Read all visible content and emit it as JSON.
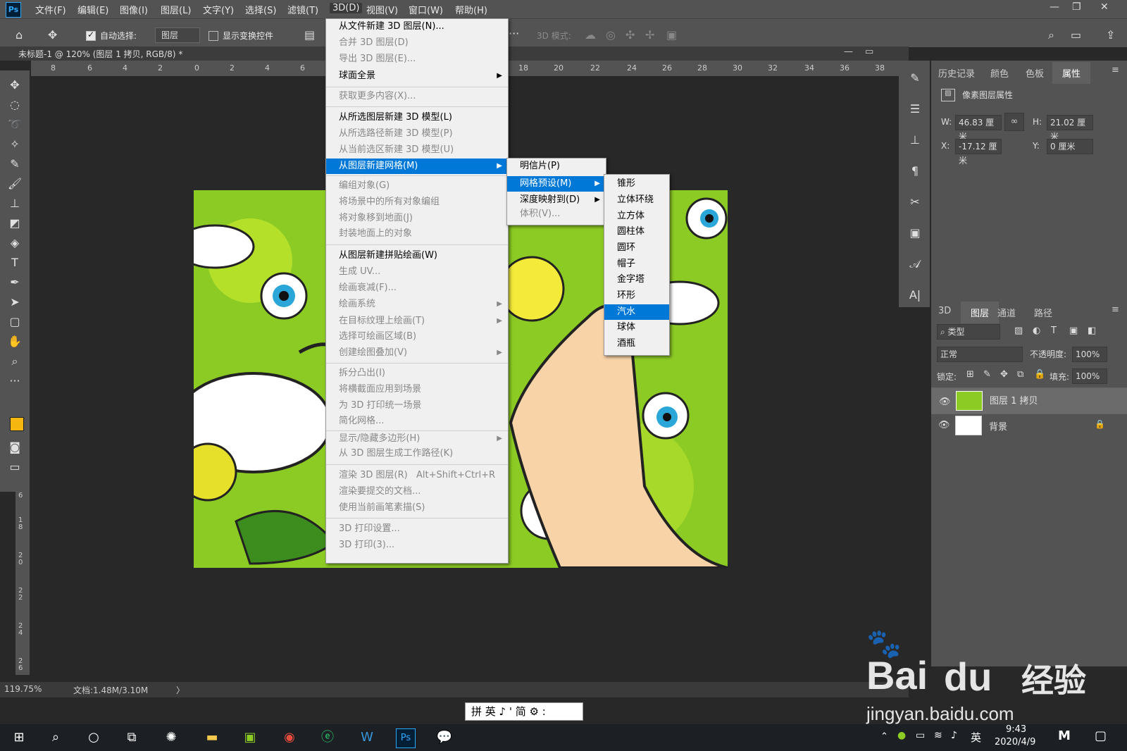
{
  "menubar": {
    "items": [
      "文件(F)",
      "编辑(E)",
      "图像(I)",
      "图层(L)",
      "文字(Y)",
      "选择(S)",
      "滤镜(T)",
      "3D(D)",
      "视图(V)",
      "窗口(W)",
      "帮助(H)"
    ],
    "app_icon": "Ps"
  },
  "optionsbar": {
    "auto_select_label": "自动选择:",
    "auto_select_value": "图层",
    "show_transform_label": "显示变换控件",
    "mode_3d_label": "3D 模式:"
  },
  "document": {
    "tab_title": "未标题-1 @ 120% (图层 1 拷贝, RGB/8) *",
    "ruler_ticks": [
      "8",
      "6",
      "4",
      "2",
      "0",
      "2",
      "4",
      "6",
      "18",
      "20",
      "22",
      "24",
      "26",
      "28",
      "30",
      "32",
      "34",
      "36",
      "38"
    ],
    "left_ruler_ticks": [
      "6",
      "1 8",
      "2 0",
      "2 2",
      "2 4",
      "2 6"
    ]
  },
  "status": {
    "zoom": "119.75%",
    "doc_size": "文档:1.48M/3.10M",
    "arrow": "〉"
  },
  "menu_3d": {
    "items": [
      {
        "label": "从文件新建 3D 图层(N)...",
        "state": "enabled"
      },
      {
        "label": "合并 3D 图层(D)",
        "state": "disabled"
      },
      {
        "label": "导出 3D 图层(E)...",
        "state": "disabled"
      },
      {
        "label": "球面全景",
        "state": "enabled",
        "submenu": true
      },
      {
        "label": "获取更多内容(X)...",
        "state": "disabled"
      },
      {
        "label": "从所选图层新建 3D 模型(L)",
        "state": "enabled"
      },
      {
        "label": "从所选路径新建 3D 模型(P)",
        "state": "disabled"
      },
      {
        "label": "从当前选区新建 3D 模型(U)",
        "state": "disabled"
      },
      {
        "label": "从图层新建网格(M)",
        "state": "highlight",
        "submenu": true
      },
      {
        "label": "编组对象(G)",
        "state": "disabled"
      },
      {
        "label": "将场景中的所有对象编组",
        "state": "disabled"
      },
      {
        "label": "将对象移到地面(J)",
        "state": "disabled"
      },
      {
        "label": "封装地面上的对象",
        "state": "disabled"
      },
      {
        "label": "从图层新建拼贴绘画(W)",
        "state": "enabled"
      },
      {
        "label": "生成 UV...",
        "state": "disabled"
      },
      {
        "label": "绘画衰减(F)...",
        "state": "disabled"
      },
      {
        "label": "绘画系统",
        "state": "disabled",
        "submenu": true
      },
      {
        "label": "在目标纹理上绘画(T)",
        "state": "disabled",
        "submenu": true
      },
      {
        "label": "选择可绘画区域(B)",
        "state": "disabled"
      },
      {
        "label": "创建绘图叠加(V)",
        "state": "disabled",
        "submenu": true
      },
      {
        "label": "拆分凸出(I)",
        "state": "disabled"
      },
      {
        "label": "将横截面应用到场景",
        "state": "disabled"
      },
      {
        "label": "为 3D 打印统一场景",
        "state": "disabled"
      },
      {
        "label": "简化网格...",
        "state": "disabled"
      },
      {
        "label": "显示/隐藏多边形(H)",
        "state": "disabled",
        "submenu": true
      },
      {
        "label": "从 3D 图层生成工作路径(K)",
        "state": "disabled"
      },
      {
        "label": "渲染 3D 图层(R)",
        "state": "disabled",
        "accel": "Alt+Shift+Ctrl+R"
      },
      {
        "label": "渲染要提交的文档...",
        "state": "disabled"
      },
      {
        "label": "使用当前画笔素描(S)",
        "state": "disabled"
      },
      {
        "label": "3D 打印设置...",
        "state": "disabled"
      },
      {
        "label": "3D 打印(3)...",
        "state": "disabled"
      }
    ]
  },
  "menu_mesh": {
    "items": [
      {
        "label": "明信片(P)",
        "state": "enabled"
      },
      {
        "label": "网格预设(M)",
        "state": "highlight",
        "submenu": true
      },
      {
        "label": "深度映射到(D)",
        "state": "enabled",
        "submenu": true
      },
      {
        "label": "体积(V)...",
        "state": "disabled"
      }
    ]
  },
  "menu_presets": {
    "items": [
      {
        "label": "锥形",
        "state": "enabled"
      },
      {
        "label": "立体环绕",
        "state": "enabled"
      },
      {
        "label": "立方体",
        "state": "enabled"
      },
      {
        "label": "圆柱体",
        "state": "enabled"
      },
      {
        "label": "圆环",
        "state": "enabled"
      },
      {
        "label": "帽子",
        "state": "enabled"
      },
      {
        "label": "金字塔",
        "state": "enabled"
      },
      {
        "label": "环形",
        "state": "enabled"
      },
      {
        "label": "汽水",
        "state": "highlight"
      },
      {
        "label": "球体",
        "state": "enabled"
      },
      {
        "label": "酒瓶",
        "state": "enabled"
      }
    ]
  },
  "properties_panel": {
    "tabs": [
      "历史记录",
      "颜色",
      "色板",
      "属性"
    ],
    "active_tab": "属性",
    "title": "像素图层属性",
    "w_label": "W:",
    "w_value": "46.83 厘米",
    "h_label": "H:",
    "h_value": "21.02 厘米",
    "x_label": "X:",
    "x_value": "-17.12 厘米",
    "y_label": "Y:",
    "y_value": "0 厘米"
  },
  "layers_panel": {
    "tabs": [
      "3D",
      "图层",
      "通道",
      "路径"
    ],
    "active_tab": "图层",
    "filter_label": "类型",
    "blend_mode": "正常",
    "opacity_label": "不透明度:",
    "opacity_value": "100%",
    "lock_label": "锁定:",
    "fill_label": "填充:",
    "fill_value": "100%",
    "layers": [
      {
        "name": "图层 1 拷贝",
        "selected": true
      },
      {
        "name": "背景",
        "selected": false,
        "locked": true
      }
    ]
  },
  "ime_bar": {
    "text": "拼 英 ♪ ' 简 ⚙ :"
  },
  "taskbar": {
    "time": "9:43",
    "date": "2020/4/9",
    "lang": "英"
  },
  "watermark": {
    "brand": "Bai",
    "brand2": "经验",
    "url": "jingyan.baidu.com"
  },
  "colors": {
    "highlight": "#0078d7",
    "menu_bg": "#f0f0f0",
    "ps_chrome": "#535353",
    "workspace": "#282828",
    "foreground_swatch": "#f5b60f"
  }
}
